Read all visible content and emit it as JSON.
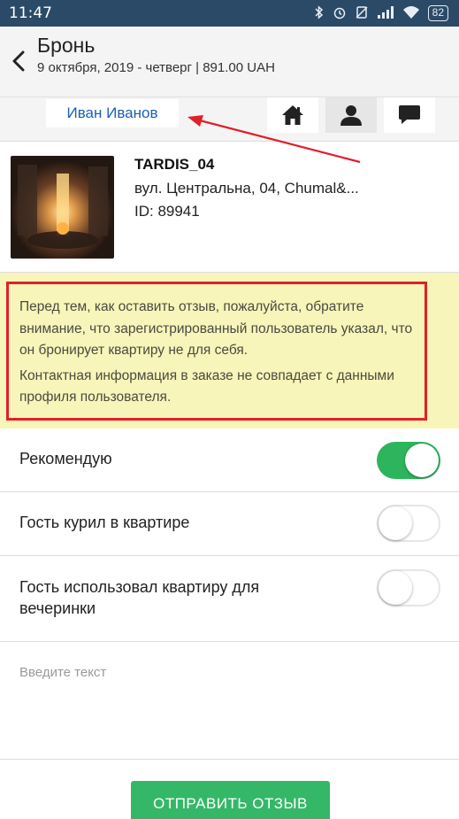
{
  "status_bar": {
    "time": "11:47",
    "battery": "82"
  },
  "header": {
    "title": "Бронь",
    "subtitle": "9 октября, 2019 - четверг | 891.00 UAH"
  },
  "user_row": {
    "user_name": "Иван Иванов",
    "buttons": [
      "home-icon",
      "user-icon",
      "chat-icon"
    ]
  },
  "property": {
    "name": "TARDIS_04",
    "address": "вул. Центральна, 04, Chumal&...",
    "id": "ID: 89941"
  },
  "warning": {
    "paragraph1": "Перед тем, как оставить отзыв, пожалуйста, обратите внимание, что зарегистрированный пользователь указал, что он бронирует квартиру не для себя.",
    "paragraph2": "Контактная информация в заказе не совпадает с данными профиля пользователя."
  },
  "toggles": [
    {
      "label": "Рекомендую",
      "on": true
    },
    {
      "label": "Гость курил в квартире",
      "on": false
    },
    {
      "label": "Гость использовал квартиру для вечеринки",
      "on": false
    }
  ],
  "comment": {
    "placeholder": "Введите текст"
  },
  "submit": {
    "label": "ОТПРАВИТЬ ОТЗЫВ"
  },
  "colors": {
    "status_bar": "#2b4a67",
    "accent_green": "#35b768",
    "warning_bg": "#f7f5b9",
    "warning_border": "#e0202a",
    "link_blue": "#1a5fb4"
  }
}
